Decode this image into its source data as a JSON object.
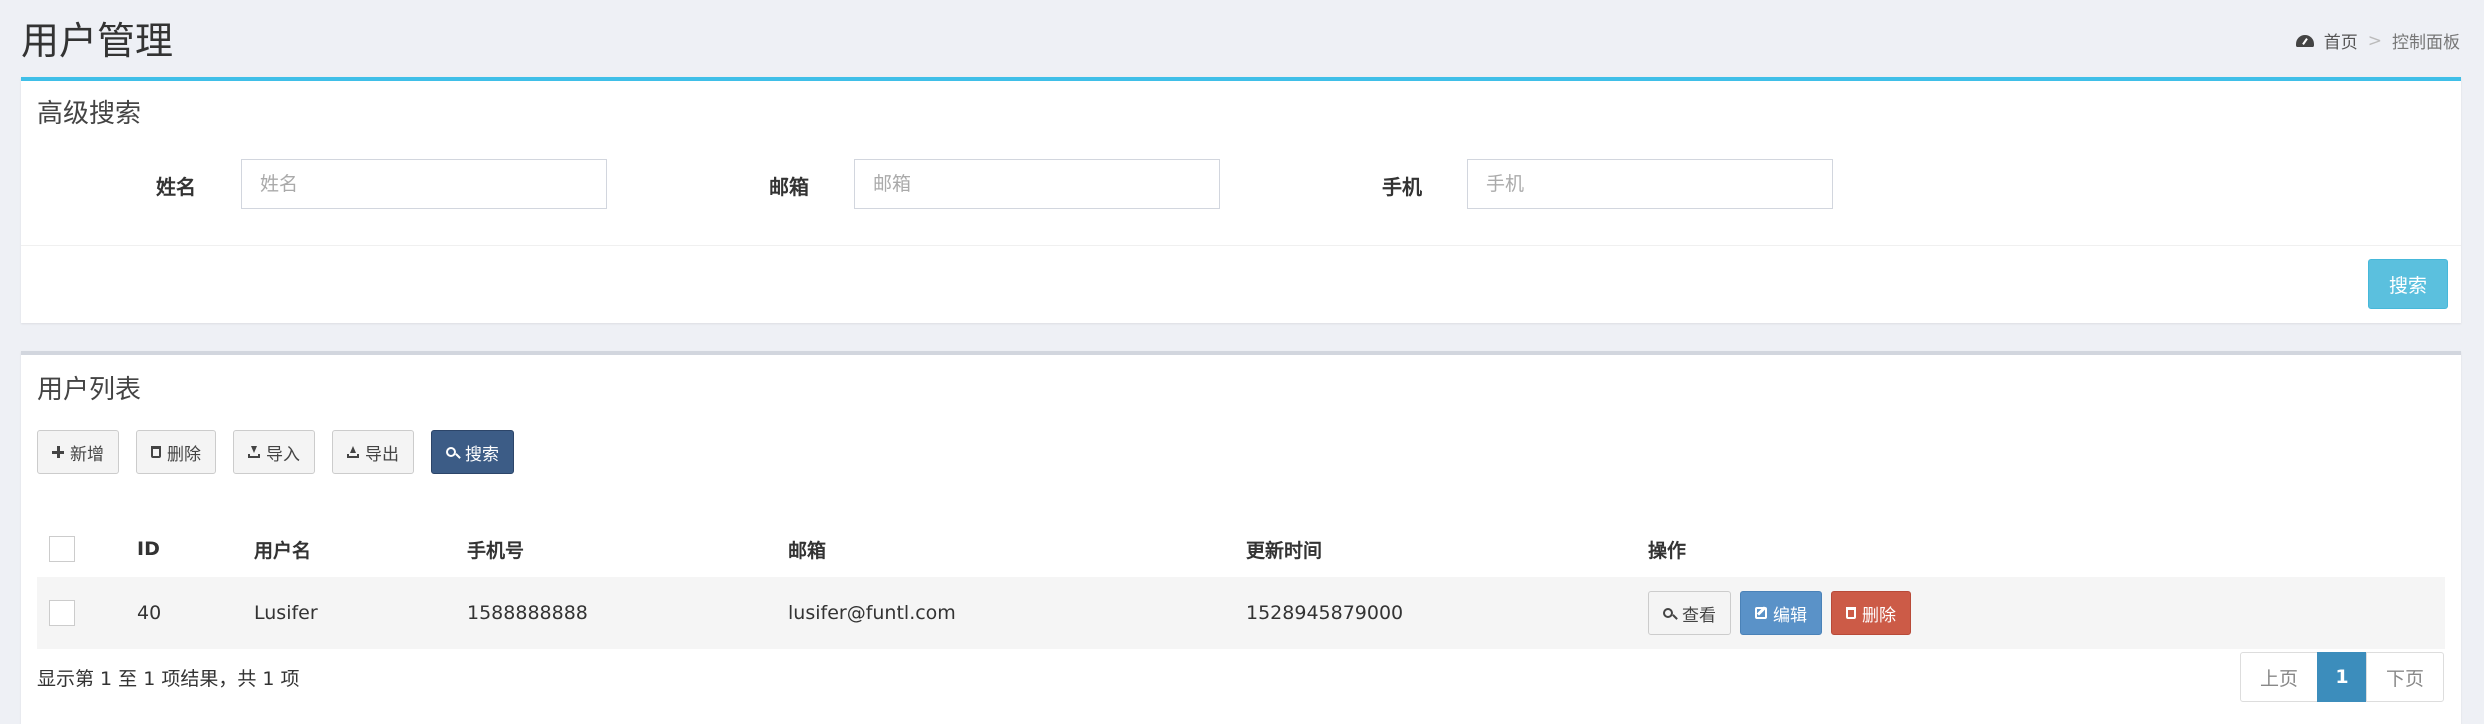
{
  "header": {
    "title": "用户管理",
    "breadcrumb": {
      "home": "首页",
      "current": "控制面板"
    }
  },
  "search_panel": {
    "title": "高级搜索",
    "fields": [
      {
        "label": "姓名",
        "placeholder": "姓名",
        "value": ""
      },
      {
        "label": "邮箱",
        "placeholder": "邮箱",
        "value": ""
      },
      {
        "label": "手机",
        "placeholder": "手机",
        "value": ""
      }
    ],
    "search_button": "搜索"
  },
  "list_panel": {
    "title": "用户列表",
    "toolbar": {
      "add": "新增",
      "delete": "删除",
      "import": "导入",
      "export": "导出",
      "search": "搜索"
    },
    "columns": [
      "ID",
      "用户名",
      "手机号",
      "邮箱",
      "更新时间",
      "操作"
    ],
    "rows": [
      {
        "id": "40",
        "username": "Lusifer",
        "phone": "1588888888",
        "email": "lusifer@funtl.com",
        "updated": "1528945879000"
      }
    ],
    "row_actions": {
      "view": "查看",
      "edit": "编辑",
      "delete": "删除"
    },
    "info": "显示第 1 至 1 项结果，共 1 项",
    "pagination": {
      "prev": "上页",
      "current": "1",
      "next": "下页"
    }
  },
  "colors": {
    "accent": "#3fbfe8",
    "primary": "#3c5c86",
    "info": "#5a92c8",
    "danger": "#cc5b47",
    "page_active": "#3c8dbc"
  }
}
